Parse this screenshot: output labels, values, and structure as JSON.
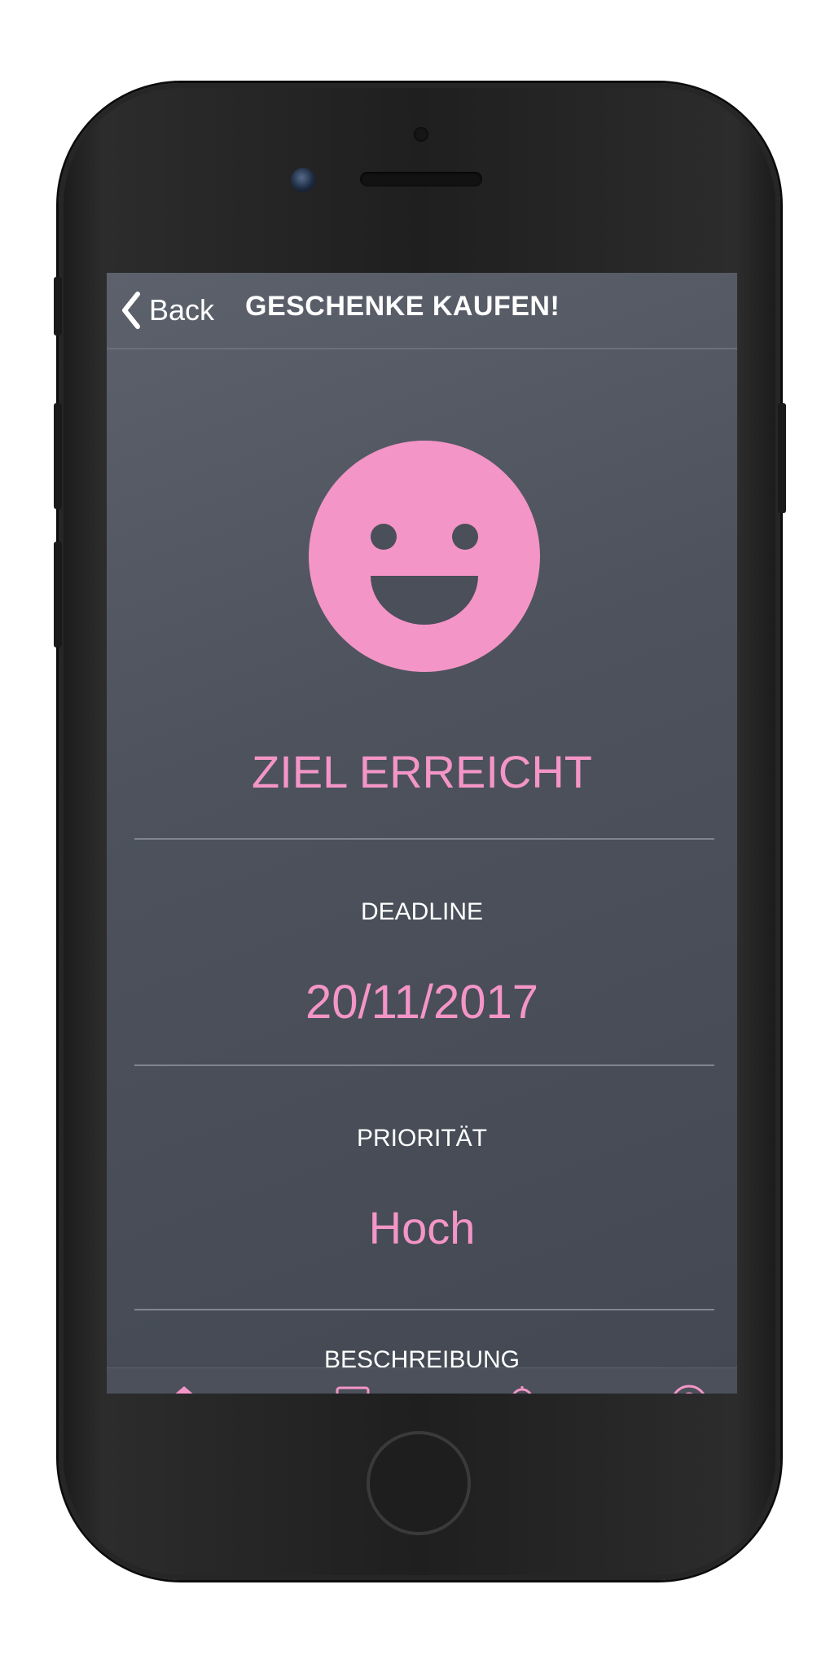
{
  "nav": {
    "back_label": "Back",
    "title": "GESCHENKE KAUFEN!"
  },
  "goal": {
    "status": "ZIEL ERREICHT",
    "status_icon": "smiley-icon"
  },
  "details": {
    "deadline_label": "DEADLINE",
    "deadline_value": "20/11/2017",
    "priority_label": "PRIORITÄT",
    "priority_value": "Hoch",
    "description_label": "BESCHREIBUNG"
  },
  "tabbar": {
    "tabs": [
      {
        "icon": "home-icon"
      },
      {
        "icon": "list-icon"
      },
      {
        "icon": "trophy-icon"
      },
      {
        "icon": "profile-icon"
      }
    ]
  },
  "colors": {
    "accent": "#f495c7",
    "screen_background": "#4d525c"
  }
}
